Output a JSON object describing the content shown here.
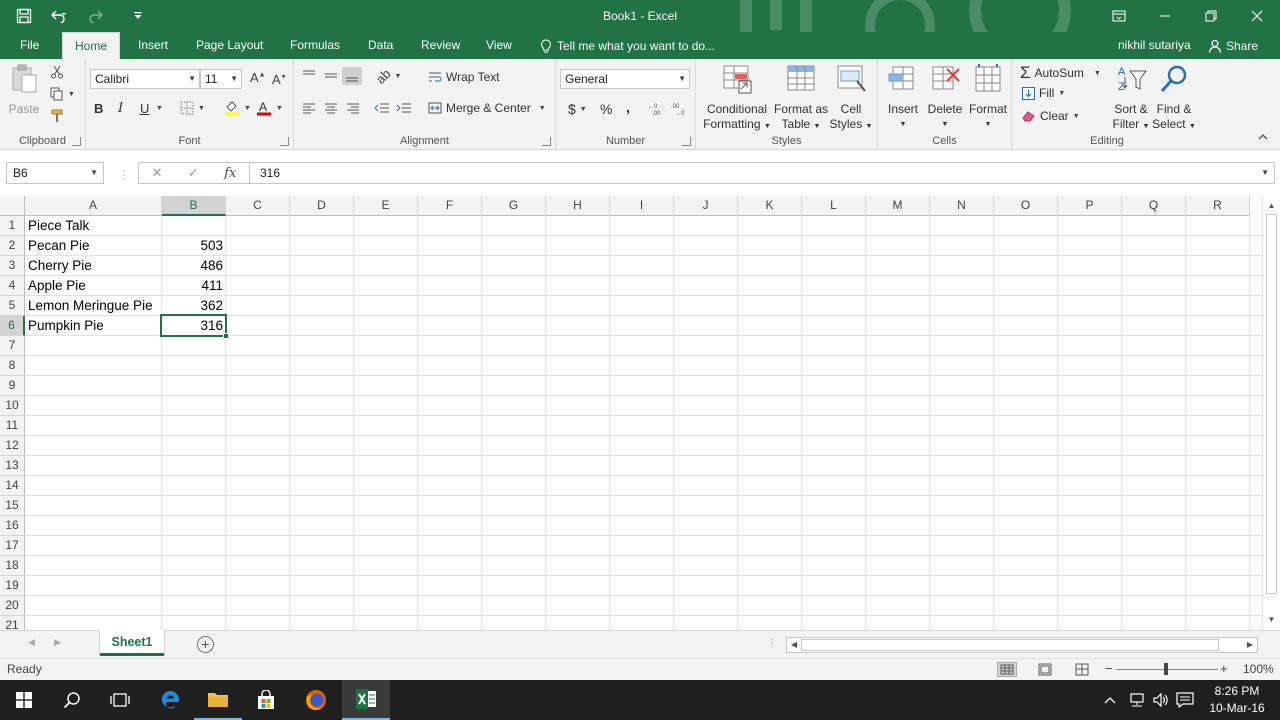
{
  "window": {
    "title": "Book1 - Excel"
  },
  "tabs": [
    "File",
    "Home",
    "Insert",
    "Page Layout",
    "Formulas",
    "Data",
    "Review",
    "View"
  ],
  "tell_me": "Tell me what you want to do...",
  "user": "nikhil sutariya",
  "share": "Share",
  "ribbon": {
    "clipboard": {
      "label": "Clipboard",
      "paste": "Paste"
    },
    "font": {
      "label": "Font",
      "name": "Calibri",
      "size": "11",
      "bold": "B",
      "italic": "I",
      "underline": "U"
    },
    "alignment": {
      "label": "Alignment",
      "wrap": "Wrap Text",
      "merge": "Merge & Center"
    },
    "number": {
      "label": "Number",
      "format": "General",
      "currency": "$",
      "percent": "%",
      "comma": ","
    },
    "styles": {
      "label": "Styles",
      "cond1": "Conditional",
      "cond2": "Formatting",
      "fmt1": "Format as",
      "fmt2": "Table",
      "cell1": "Cell",
      "cell2": "Styles"
    },
    "cells": {
      "label": "Cells",
      "insert": "Insert",
      "delete": "Delete",
      "format": "Format"
    },
    "editing": {
      "label": "Editing",
      "autosum": "AutoSum",
      "fill": "Fill",
      "clear": "Clear",
      "sort1": "Sort &",
      "sort2": "Filter",
      "find1": "Find &",
      "find2": "Select"
    }
  },
  "formula_bar": {
    "name_box": "B6",
    "fx": "fx",
    "value": "316"
  },
  "columns": [
    "A",
    "B",
    "C",
    "D",
    "E",
    "F",
    "G",
    "H",
    "I",
    "J",
    "K",
    "L",
    "M",
    "N",
    "O",
    "P",
    "Q",
    "R"
  ],
  "rows": [
    "1",
    "2",
    "3",
    "4",
    "5",
    "6",
    "7",
    "8",
    "9",
    "10",
    "11",
    "12",
    "13",
    "14",
    "15",
    "16",
    "17",
    "18",
    "19",
    "20",
    "21"
  ],
  "cells": {
    "A1": "Piece Talk",
    "A2": "Pecan Pie",
    "B2": "503",
    "A3": "Cherry Pie",
    "B3": "486",
    "A4": "Apple Pie",
    "B4": "411",
    "A5": "Lemon Meringue Pie",
    "B5": "362",
    "A6": "Pumpkin Pie",
    "B6": "316"
  },
  "sheet": {
    "name": "Sheet1"
  },
  "status": {
    "text": "Ready",
    "zoom": "100%"
  },
  "taskbar": {
    "time": "8:26 PM",
    "date": "10-Mar-16"
  },
  "colors": {
    "excel_green": "#217346"
  }
}
